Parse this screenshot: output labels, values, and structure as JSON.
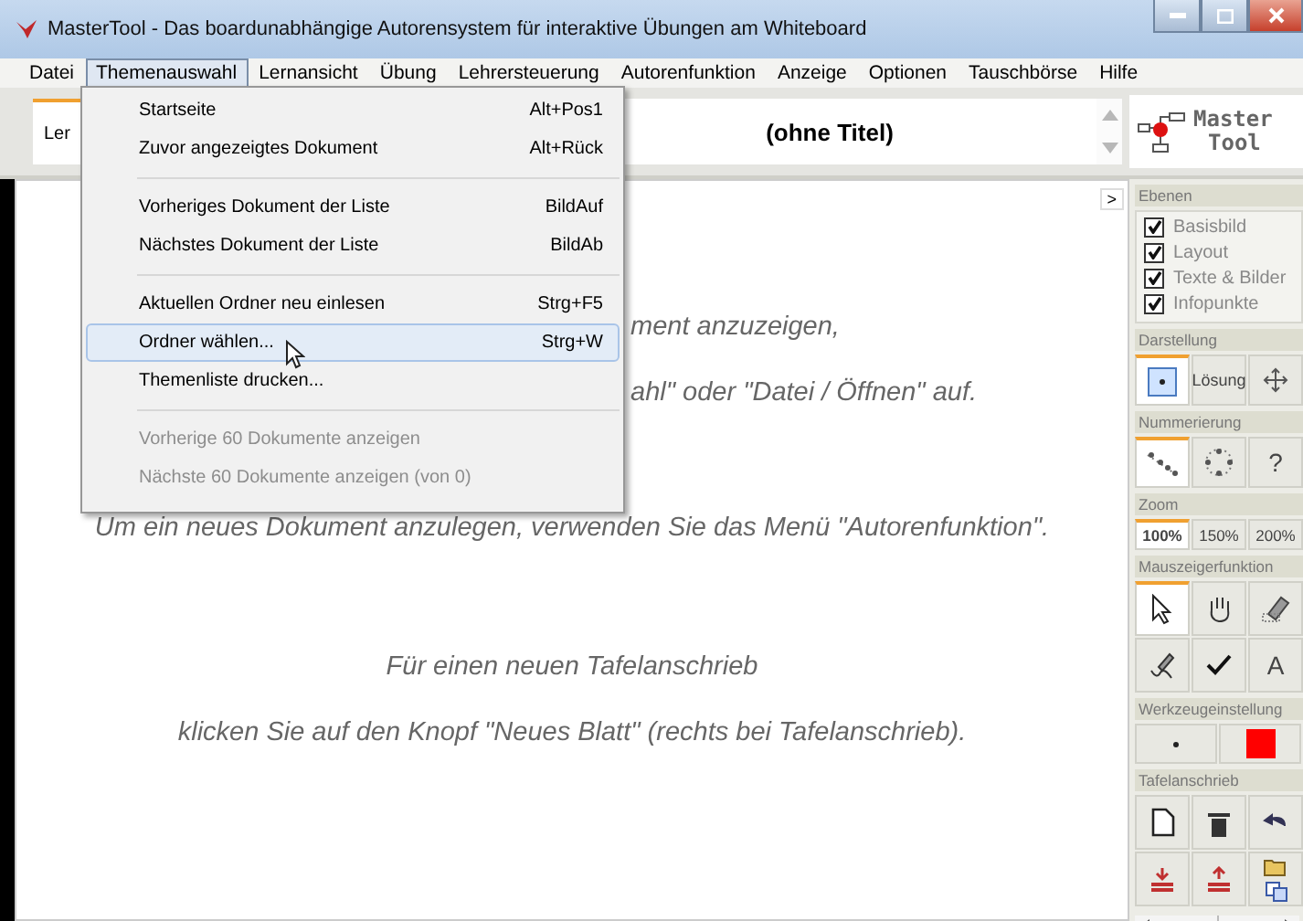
{
  "window": {
    "title": "MasterTool - Das boardunabhängige Autorensystem für interaktive Übungen am Whiteboard"
  },
  "menu_bar": [
    {
      "label": "Datei",
      "selected": false
    },
    {
      "label": "Themenauswahl",
      "selected": true
    },
    {
      "label": "Lernansicht",
      "selected": false
    },
    {
      "label": "Übung",
      "selected": false
    },
    {
      "label": "Lehrersteuerung",
      "selected": false
    },
    {
      "label": "Autorenfunktion",
      "selected": false
    },
    {
      "label": "Anzeige",
      "selected": false
    },
    {
      "label": "Optionen",
      "selected": false
    },
    {
      "label": "Tauschbörse",
      "selected": false
    },
    {
      "label": "Hilfe",
      "selected": false
    }
  ],
  "open_menu": {
    "groups": [
      [
        {
          "label": "Startseite",
          "shortcut": "Alt+Pos1",
          "disabled": false,
          "selected": false
        },
        {
          "label": "Zuvor angezeigtes Dokument",
          "shortcut": "Alt+Rück",
          "disabled": false,
          "selected": false
        }
      ],
      [
        {
          "label": "Vorheriges Dokument der Liste",
          "shortcut": "BildAuf",
          "disabled": false,
          "selected": false
        },
        {
          "label": "Nächstes Dokument der Liste",
          "shortcut": "BildAb",
          "disabled": false,
          "selected": false
        }
      ],
      [
        {
          "label": "Aktuellen Ordner neu einlesen",
          "shortcut": "Strg+F5",
          "disabled": false,
          "selected": false
        },
        {
          "label": "Ordner wählen...",
          "shortcut": "Strg+W",
          "disabled": false,
          "selected": true
        },
        {
          "label": "Themenliste drucken...",
          "disabled": false,
          "selected": false
        }
      ],
      [
        {
          "label": "Vorherige 60 Dokumente anzeigen",
          "disabled": true,
          "selected": false
        },
        {
          "label": "Nächste 60 Dokumente anzeigen (von 0)",
          "disabled": true,
          "selected": false
        }
      ]
    ]
  },
  "toolbar": {
    "tab": "Ler",
    "title": "(ohne Titel)",
    "logo": [
      "Master",
      "Tool"
    ]
  },
  "content": {
    "expand_button": ">",
    "lines": [
      {
        "text": "ment anzuzeigen,",
        "kind": "partial"
      },
      {
        "text": "ahl\" oder \"Datei / Öffnen\" auf.",
        "kind": "partial"
      },
      {
        "text": "Um ein neues Dokument anzulegen, verwenden Sie das Menü \"Autorenfunktion\".",
        "kind": "full"
      },
      {
        "text": "Für einen neuen Tafelanschrieb",
        "kind": "full"
      },
      {
        "text": "klicken Sie auf den Knopf \"Neues Blatt\" (rechts bei Tafelanschrieb).",
        "kind": "full"
      }
    ]
  },
  "sidebar": {
    "sections": [
      {
        "title": "Ebenen",
        "kind": "checks",
        "items": [
          {
            "label": "Basisbild",
            "checked": true
          },
          {
            "label": "Layout",
            "checked": true
          },
          {
            "label": "Texte & Bilder",
            "checked": true
          },
          {
            "label": "Infopunkte",
            "checked": true
          }
        ]
      },
      {
        "title": "Darstellung",
        "kind": "tools",
        "items": [
          {
            "kind": "icon",
            "selected": true
          },
          {
            "kind": "text",
            "label": "Lösung",
            "selected": false
          },
          {
            "kind": "icon",
            "selected": false
          }
        ]
      },
      {
        "title": "Nummerierung",
        "kind": "tools",
        "items": [
          {
            "kind": "icon",
            "selected": true
          },
          {
            "kind": "icon",
            "selected": false
          },
          {
            "kind": "text",
            "label": "?",
            "selected": false
          }
        ]
      },
      {
        "title": "Zoom",
        "kind": "tools",
        "items": [
          {
            "kind": "text",
            "label": "100%",
            "selected": true
          },
          {
            "kind": "text",
            "label": "150%",
            "selected": false
          },
          {
            "kind": "text",
            "label": "200%",
            "selected": false
          }
        ]
      },
      {
        "title": "Mauszeigerfunktion",
        "kind": "tools",
        "items": [
          {
            "kind": "icon",
            "selected": true
          },
          {
            "kind": "icon",
            "selected": false
          },
          {
            "kind": "icon",
            "selected": false
          },
          {
            "kind": "icon",
            "selected": false
          },
          {
            "kind": "icon",
            "selected": false
          },
          {
            "kind": "text",
            "label": "A",
            "selected": false
          }
        ]
      },
      {
        "title": "Werkzeugeinstellung",
        "kind": "wide",
        "items": [
          {
            "kind": "icon",
            "selected": false
          },
          {
            "kind": "swatch",
            "color": "#ff0000",
            "selected": false
          }
        ]
      },
      {
        "title": "Tafelanschrieb",
        "kind": "tools",
        "items": [
          {
            "kind": "icon",
            "selected": false
          },
          {
            "kind": "icon",
            "selected": false
          },
          {
            "kind": "icon",
            "selected": false
          },
          {
            "kind": "icon",
            "selected": false
          },
          {
            "kind": "icon",
            "selected": false
          },
          {
            "kind": "stack",
            "selected": false
          }
        ]
      }
    ]
  }
}
